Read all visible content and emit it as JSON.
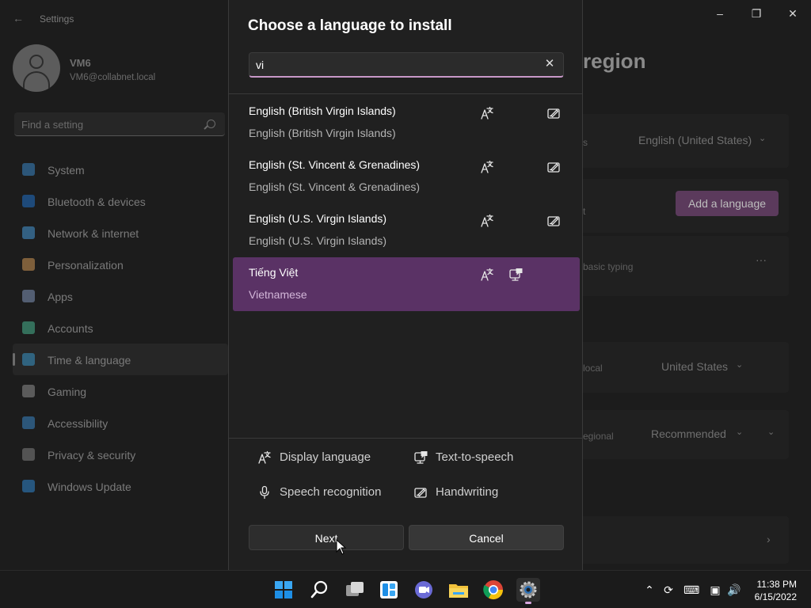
{
  "settings": {
    "app_title": "Settings",
    "user": {
      "name": "VM6",
      "email": "VM6@collabnet.local"
    },
    "search_placeholder": "Find a setting",
    "nav": [
      {
        "label": "System",
        "icon": "system-icon",
        "color": "#3b8fd6"
      },
      {
        "label": "Bluetooth & devices",
        "icon": "bluetooth-icon",
        "color": "#1f77d8"
      },
      {
        "label": "Network & internet",
        "icon": "wifi-icon",
        "color": "#4aa3e8"
      },
      {
        "label": "Personalization",
        "icon": "brush-icon",
        "color": "#e0a25a"
      },
      {
        "label": "Apps",
        "icon": "apps-icon",
        "color": "#8aa0c8"
      },
      {
        "label": "Accounts",
        "icon": "accounts-icon",
        "color": "#4cc29a"
      },
      {
        "label": "Time & language",
        "icon": "globe-clock-icon",
        "color": "#3aa0d8",
        "active": true
      },
      {
        "label": "Gaming",
        "icon": "gaming-icon",
        "color": "#9a9a9a"
      },
      {
        "label": "Accessibility",
        "icon": "accessibility-icon",
        "color": "#3b8fd6"
      },
      {
        "label": "Privacy & security",
        "icon": "shield-icon",
        "color": "#8a8a8a"
      },
      {
        "label": "Windows Update",
        "icon": "update-icon",
        "color": "#2f8fe0"
      }
    ],
    "page_title_fragment": "region",
    "right": {
      "row1_frag": "s",
      "windows_display_language": "English (United States)",
      "add_language_label": "Add a language",
      "row2_frag": "t",
      "row3_frag": "basic typing",
      "more": "···",
      "country_frag": "local",
      "country_value": "United States",
      "format_frag": "egional",
      "format_value": "Recommended"
    }
  },
  "dialog": {
    "title": "Choose a language to install",
    "search_value": "vi",
    "languages": [
      {
        "name": "English (British Virgin Islands)",
        "sub": "English (British Virgin Islands)",
        "features": [
          "display",
          "handwriting"
        ]
      },
      {
        "name": "English (St. Vincent & Grenadines)",
        "sub": "English (St. Vincent & Grenadines)",
        "features": [
          "display",
          "handwriting"
        ]
      },
      {
        "name": "English (U.S. Virgin Islands)",
        "sub": "English (U.S. Virgin Islands)",
        "features": [
          "display",
          "handwriting"
        ]
      },
      {
        "name": "Tiếng Việt",
        "sub": "Vietnamese",
        "features": [
          "display",
          "tts"
        ],
        "selected": true
      }
    ],
    "legend": {
      "display": "Display language",
      "tts": "Text-to-speech",
      "speech": "Speech recognition",
      "handwriting": "Handwriting"
    },
    "next_label": "Next",
    "cancel_label": "Cancel"
  },
  "taskbar": {
    "apps": [
      "start-icon",
      "search-icon",
      "task-view-icon",
      "widgets-icon",
      "teams-chat-icon",
      "file-explorer-icon",
      "chrome-icon",
      "settings-gear-icon"
    ],
    "time": "11:38 PM",
    "date": "6/15/2022"
  }
}
